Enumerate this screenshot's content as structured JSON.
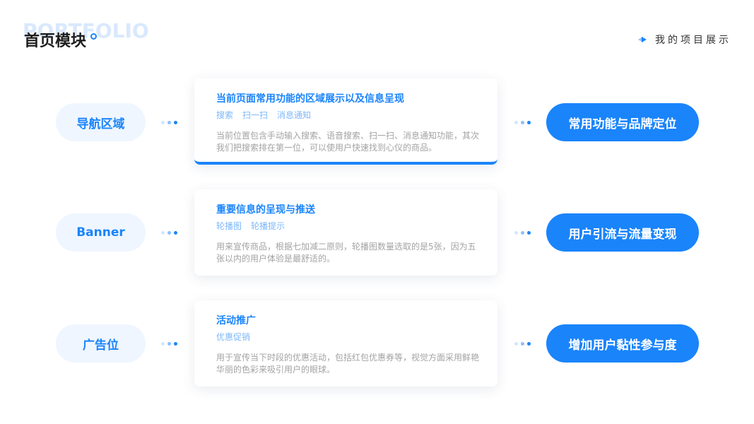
{
  "header": {
    "watermark": "PORTFOLIO",
    "title": "首页模块",
    "right_label": "我的项目展示"
  },
  "rows": [
    {
      "left": "导航区域",
      "card_title": "当前页面常用功能的区域展示以及信息呈现",
      "tags": [
        "搜索",
        "扫一扫",
        "消息通知"
      ],
      "description": "当前位置包含手动输入搜索、语音搜索、扫一扫、消息通知功能，其次我们把搜索排在第一位，可以使用户快速找到心仪的商品。",
      "right": "常用功能与品牌定位"
    },
    {
      "left": "Banner",
      "card_title": "重要信息的呈现与推送",
      "tags": [
        "轮播图",
        "轮播提示"
      ],
      "description": "用来宣传商品，根据七加减二原则，轮播图数量选取的是5张，因为五张以内的用户体验是最舒适的。",
      "right": "用户引流与流量变现"
    },
    {
      "left": "广告位",
      "card_title": "活动推广",
      "tags": [
        "优惠促销"
      ],
      "description": "用于宣传当下时段的优惠活动，包括红包优惠券等，视觉方面采用鲜艳华丽的色彩来吸引用户的眼球。",
      "right": "增加用户黏性参与度"
    }
  ],
  "colors": {
    "accent": "#1a84fb",
    "pill_light": "#eff6ff",
    "tag": "#7db7fb",
    "desc": "#a3a3a3"
  }
}
